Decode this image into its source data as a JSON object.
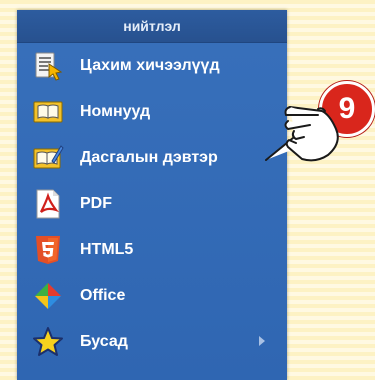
{
  "menu": {
    "header": "нийтлэл",
    "items": [
      {
        "label": "Цахим хичээлүүд",
        "icon": "document-cursor-icon"
      },
      {
        "label": "Номнууд",
        "icon": "book-icon"
      },
      {
        "label": "Дасгалын дэвтэр",
        "icon": "workbook-icon"
      },
      {
        "label": "PDF",
        "icon": "pdf-icon"
      },
      {
        "label": "HTML5",
        "icon": "html5-icon"
      },
      {
        "label": "Office",
        "icon": "office-icon"
      },
      {
        "label": "Бусад",
        "icon": "star-icon",
        "has_submenu": true
      }
    ]
  },
  "callout": {
    "number": "9"
  },
  "colors": {
    "menu_bg": "#2f66b2",
    "header_bg": "#27518f",
    "badge": "#d9261c",
    "background": "#fdf2c4"
  }
}
